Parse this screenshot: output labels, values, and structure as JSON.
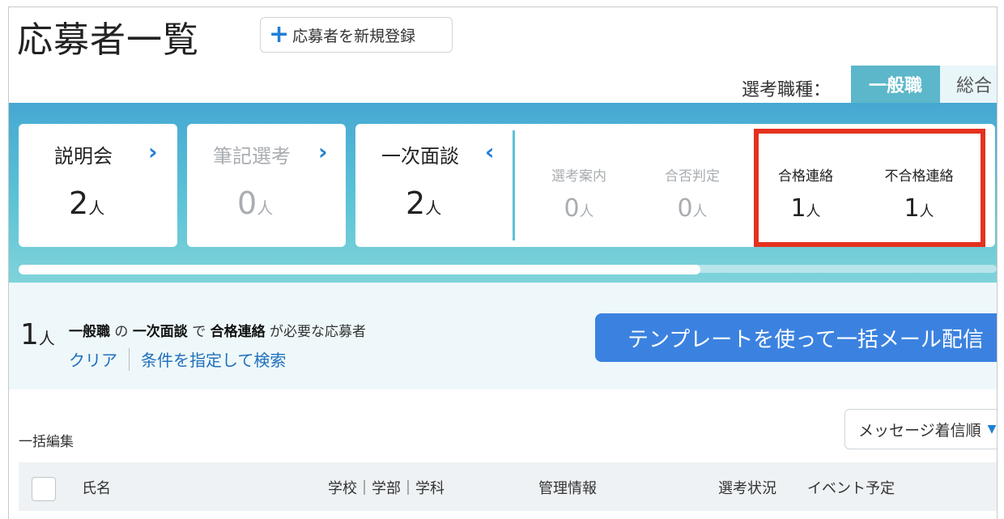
{
  "header": {
    "title": "応募者一覧",
    "new_button_icon": "plus-icon",
    "new_button_label": "応募者を新規登録"
  },
  "job_type": {
    "label": "選考職種：",
    "tabs": [
      {
        "label": "一般職",
        "active": true
      },
      {
        "label": "総合",
        "active": false
      }
    ]
  },
  "stages": {
    "unit": "人",
    "briefing": {
      "title": "説明会",
      "count": "2",
      "arrow": "›"
    },
    "written": {
      "title": "筆記選考",
      "count": "0",
      "arrow": "›"
    },
    "interview": {
      "title": "一次面談",
      "count": "2",
      "arrow": "‹",
      "substeps": [
        {
          "title": "選考案内",
          "count": "0"
        },
        {
          "title": "合否判定",
          "count": "0"
        },
        {
          "title": "合格連絡",
          "count": "1"
        },
        {
          "title": "不合格連絡",
          "count": "1"
        }
      ]
    }
  },
  "filter": {
    "count": "1",
    "unit": "人",
    "job": "一般職",
    "particle_no": "の",
    "stage": "一次面談",
    "particle_de": "で",
    "step": "合格連絡",
    "suffix": "が必要な応募者",
    "clear_link": "クリア",
    "search_link": "条件を指定して検索",
    "mail_button": "テンプレートを使って一括メール配信"
  },
  "list": {
    "bulk_edit": "一括編集",
    "sort_label": "メッセージ着信順",
    "columns": [
      "氏名",
      "学校｜学部｜学科",
      "管理情報",
      "選考状況",
      "イベント予定"
    ]
  },
  "colors": {
    "accent": "#1f7fd6",
    "band": "#5cc3d6",
    "highlight": "#e3321f",
    "mail_button": "#3b82e0"
  }
}
